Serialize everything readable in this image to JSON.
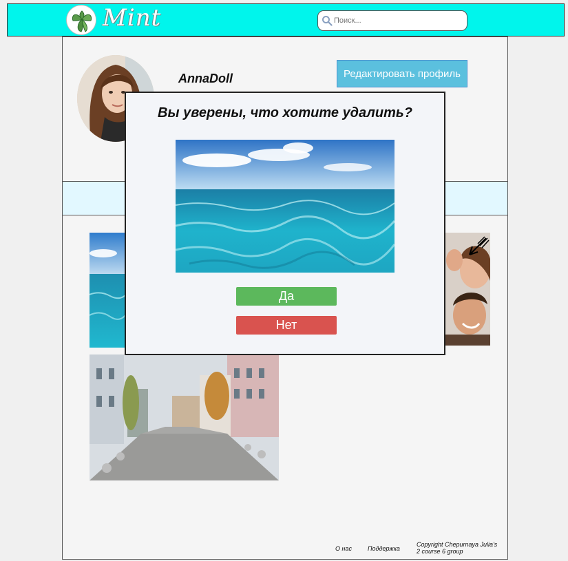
{
  "header": {
    "logo_text": "Mint",
    "search_placeholder": "Поиск..."
  },
  "profile": {
    "username": "AnnaDoll",
    "edit_button_label": "Редактировать профиль"
  },
  "modal": {
    "title": "Вы уверены, что хотите удалить?",
    "yes_label": "Да",
    "no_label": "Нет"
  },
  "footer": {
    "about_label": "О нас",
    "support_label": "Поддержка",
    "copyright_line1": "Copyright Chepurnaya Julia's",
    "copyright_line2": "2 course  6 group"
  },
  "colors": {
    "header_bg": "#00f5ec",
    "edit_button": "#5bc0de",
    "yes_button": "#5cb85c",
    "no_button": "#d9534f",
    "band": "#e2f8ff"
  },
  "icons": [
    "mint-leaf-logo-icon",
    "search-icon",
    "cursor-arrow-icon"
  ]
}
